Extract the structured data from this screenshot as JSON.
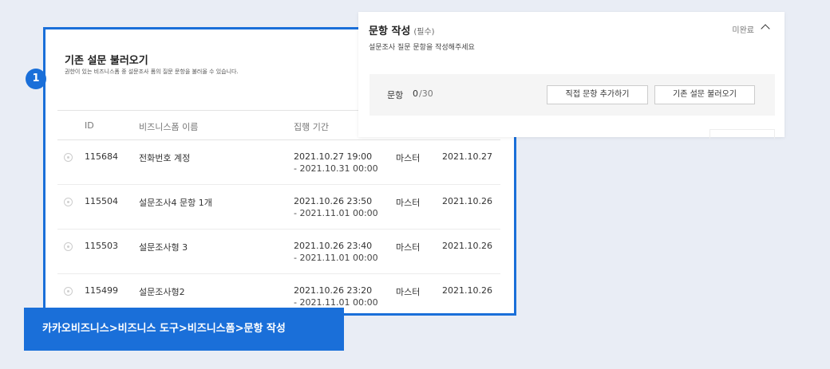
{
  "load_panel": {
    "title": "기존 설문 불러오기",
    "description": "권한이 있는 비즈니스폼 중 설문조사 폼의 질문 문항을 불러올 수 있습니다.",
    "columns": [
      "ID",
      "비즈니스폼 이름",
      "집행 기간"
    ],
    "rows": [
      {
        "id": "115684",
        "name": "전화번호 계정",
        "start": "2021.10.27 19:00",
        "end": "- 2021.10.31 00:00",
        "owner": "마스터",
        "date": "2021.10.27"
      },
      {
        "id": "115504",
        "name": "설문조사4 문항 1개",
        "start": "2021.10.26 23:50",
        "end": "- 2021.11.01 00:00",
        "owner": "마스터",
        "date": "2021.10.26"
      },
      {
        "id": "115503",
        "name": "설문조사형 3",
        "start": "2021.10.26 23:40",
        "end": "- 2021.11.01 00:00",
        "owner": "마스터",
        "date": "2021.10.26"
      },
      {
        "id": "115499",
        "name": "설문조사형2",
        "start": "2021.10.26 23:20",
        "end": "- 2021.11.01 00:00",
        "owner": "마스터",
        "date": "2021.10.26"
      }
    ]
  },
  "step_badge": "1",
  "question_panel": {
    "title": "문항 작성",
    "required": "(필수)",
    "description": "설문조사 질문 문항을 작성해주세요",
    "status": "미완료",
    "count_label": "문항",
    "count_value": "0",
    "count_max": "/30",
    "direct_add_button": "직접 문항 추가하기",
    "load_button": "기존 설문 불러오기"
  },
  "caption": "카카오비즈니스>비즈니스 도구>비즈니스폼>문항 작성",
  "colors": {
    "accent": "#1a6fd9",
    "background": "#e9edf5"
  }
}
